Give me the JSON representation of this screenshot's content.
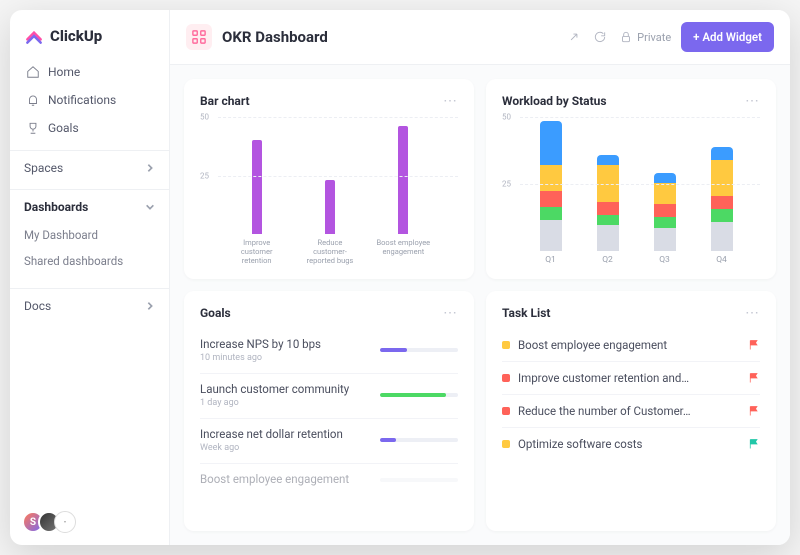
{
  "brand": {
    "name": "ClickUp"
  },
  "sidebar": {
    "nav": [
      {
        "label": "Home",
        "icon": "home"
      },
      {
        "label": "Notifications",
        "icon": "bell"
      },
      {
        "label": "Goals",
        "icon": "trophy"
      }
    ],
    "sections": [
      {
        "label": "Spaces",
        "expanded": false,
        "items": []
      },
      {
        "label": "Dashboards",
        "expanded": true,
        "items": [
          "My Dashboard",
          "Shared dashboards"
        ]
      },
      {
        "label": "Docs",
        "expanded": false,
        "items": []
      }
    ]
  },
  "header": {
    "title": "OKR Dashboard",
    "privacy": "Private",
    "add_widget_label": "+ Add Widget"
  },
  "cards": {
    "bar": {
      "title": "Bar chart"
    },
    "workload": {
      "title": "Workload by Status"
    },
    "goals": {
      "title": "Goals"
    },
    "tasks": {
      "title": "Task List"
    }
  },
  "chart_data": [
    {
      "id": "bar",
      "type": "bar",
      "title": "Bar chart",
      "categories": [
        "Improve customer retention",
        "Reduce customer-reported bugs",
        "Boost employee engagement"
      ],
      "values": [
        40,
        23,
        46
      ],
      "ylim": [
        0,
        50
      ],
      "yticks": [
        25,
        50
      ],
      "color": "#b355e0"
    },
    {
      "id": "workload",
      "type": "stacked-bar",
      "title": "Workload by Status",
      "categories": [
        "Q1",
        "Q2",
        "Q3",
        "Q4"
      ],
      "series_order": [
        "gray",
        "green",
        "red",
        "yellow",
        "blue"
      ],
      "series_colors": {
        "gray": "#d9dce5",
        "green": "#4cd964",
        "red": "#ff6259",
        "yellow": "#ffc940",
        "blue": "#3b9cff"
      },
      "stacks": [
        {
          "gray": 12,
          "green": 5,
          "red": 6,
          "yellow": 10,
          "blue": 17
        },
        {
          "gray": 10,
          "green": 4,
          "red": 5,
          "yellow": 14,
          "blue": 4
        },
        {
          "gray": 9,
          "green": 4,
          "red": 5,
          "yellow": 8,
          "blue": 4
        },
        {
          "gray": 11,
          "green": 5,
          "red": 5,
          "yellow": 14,
          "blue": 5
        }
      ],
      "ylim": [
        0,
        50
      ],
      "yticks": [
        25,
        50
      ]
    }
  ],
  "goals": [
    {
      "name": "Increase NPS by 10 bps",
      "time": "10 minutes ago",
      "progress": 35,
      "color": "#7b68ee"
    },
    {
      "name": "Launch customer community",
      "time": "1 day ago",
      "progress": 85,
      "color": "#4cd964"
    },
    {
      "name": "Increase net dollar retention",
      "time": "Week ago",
      "progress": 20,
      "color": "#7b68ee"
    },
    {
      "name": "Boost employee engagement",
      "time": "",
      "progress": 0,
      "color": "#7b68ee",
      "faded": true
    }
  ],
  "tasks": [
    {
      "name": "Boost employee engagement",
      "dot": "#ffc940",
      "flag": "#ff6259"
    },
    {
      "name": "Improve customer retention and…",
      "dot": "#ff6259",
      "flag": "#ff6259"
    },
    {
      "name": "Reduce the number of Customer…",
      "dot": "#ff6259",
      "flag": "#ff6259"
    },
    {
      "name": "Optimize software costs",
      "dot": "#ffc940",
      "flag": "#21c7a8"
    }
  ]
}
